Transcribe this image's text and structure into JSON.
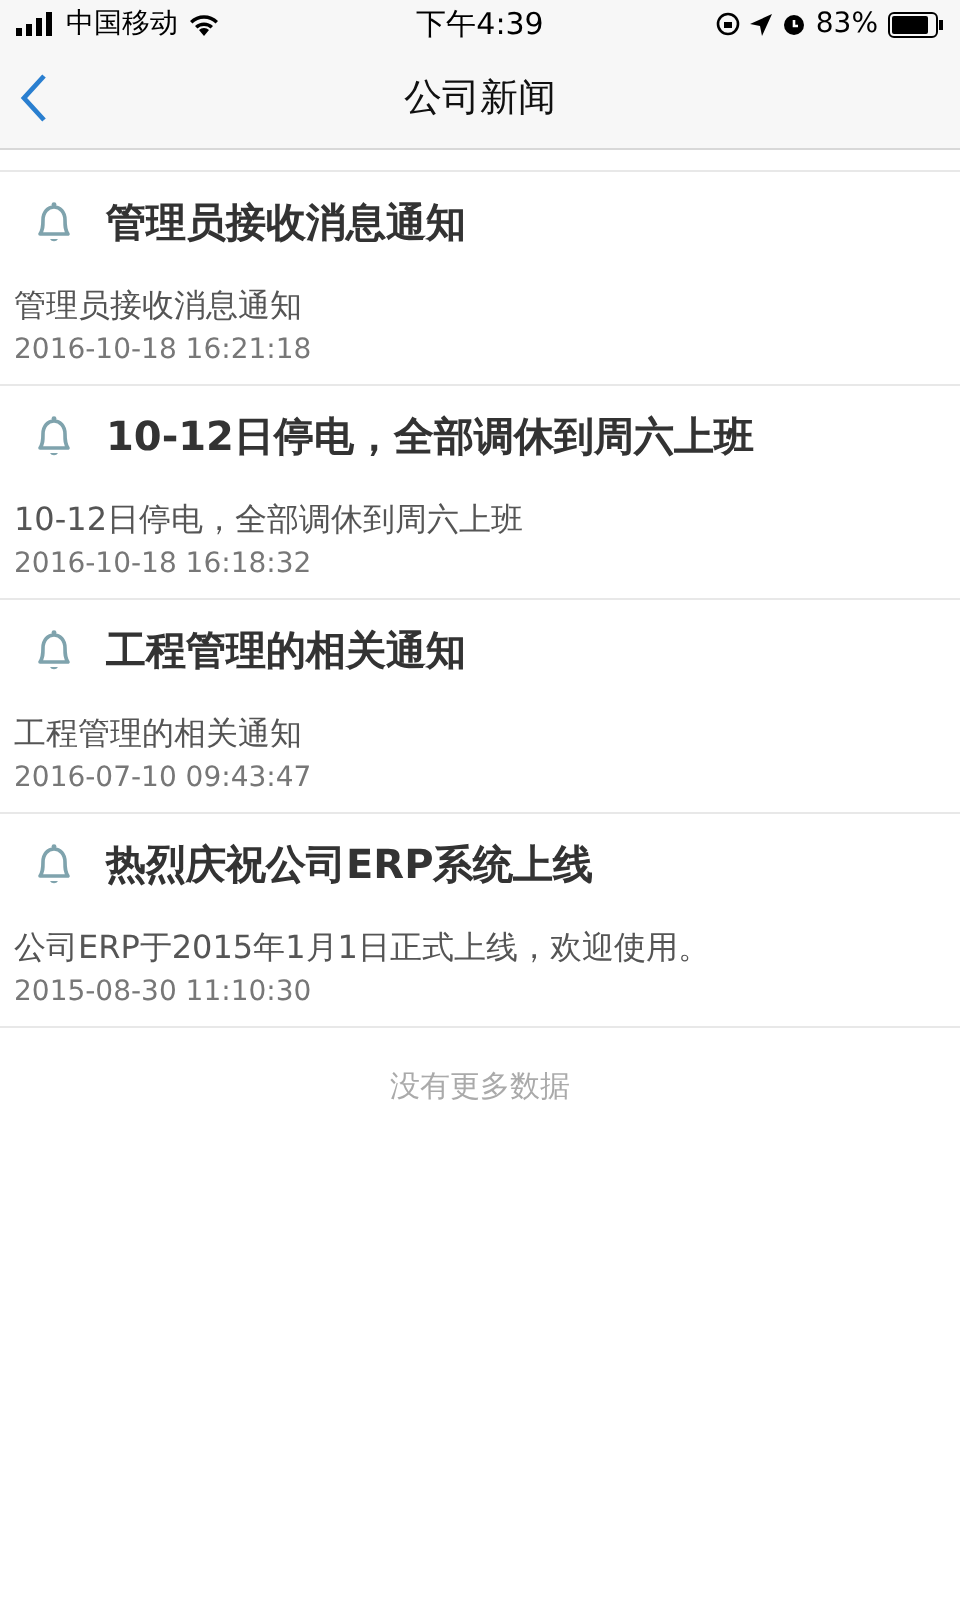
{
  "status_bar": {
    "carrier": "中国移动",
    "time": "下午4:39",
    "battery": "83%"
  },
  "nav": {
    "title": "公司新闻"
  },
  "news": [
    {
      "title": "管理员接收消息通知",
      "body": "管理员接收消息通知",
      "date": "2016-10-18 16:21:18"
    },
    {
      "title": "10-12日停电，全部调休到周六上班",
      "body": "10-12日停电，全部调休到周六上班",
      "date": "2016-10-18 16:18:32"
    },
    {
      "title": "工程管理的相关通知",
      "body": "工程管理的相关通知",
      "date": "2016-07-10 09:43:47"
    },
    {
      "title": "热烈庆祝公司ERP系统上线",
      "body": "公司ERP于2015年1月1日正式上线，欢迎使用。",
      "date": "2015-08-30 11:10:30"
    }
  ],
  "footer": "没有更多数据"
}
